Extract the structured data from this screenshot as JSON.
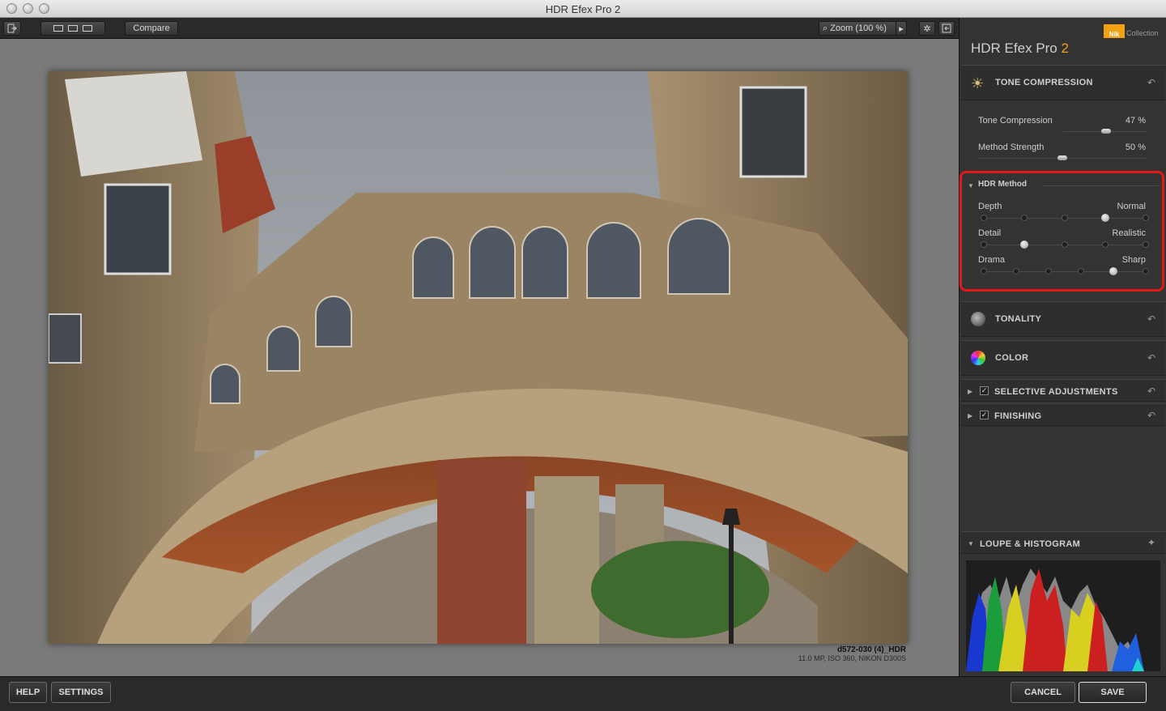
{
  "window": {
    "title": "HDR Efex Pro 2"
  },
  "toolbar": {
    "compare_label": "Compare",
    "zoom_label": "Zoom (100 %)"
  },
  "file": {
    "name": "d572-030 (4)_HDR",
    "meta": "11.0 MP, ISO 360, NIKON D300S"
  },
  "panel": {
    "brand": "Nik",
    "collection": "Collection",
    "app_name": "HDR Efex Pro",
    "app_version": "2",
    "tone_compression": {
      "title": "TONE COMPRESSION",
      "params": [
        {
          "label": "Tone Compression",
          "value_text": "47 %",
          "value": 47
        },
        {
          "label": "Method Strength",
          "value_text": "50 %",
          "value": 50
        }
      ]
    },
    "hdr_method": {
      "title": "HDR Method",
      "rows": [
        {
          "left": "Depth",
          "right": "Normal",
          "stops": 5,
          "selected": 3
        },
        {
          "left": "Detail",
          "right": "Realistic",
          "stops": 5,
          "selected": 1
        },
        {
          "left": "Drama",
          "right": "Sharp",
          "stops": 6,
          "selected": 4
        }
      ]
    },
    "tonality": {
      "title": "TONALITY"
    },
    "color": {
      "title": "COLOR"
    },
    "selective": {
      "title": "SELECTIVE ADJUSTMENTS"
    },
    "finishing": {
      "title": "FINISHING"
    },
    "loupe": {
      "title": "LOUPE & HISTOGRAM"
    }
  },
  "bottom": {
    "help": "HELP",
    "settings": "SETTINGS",
    "cancel": "CANCEL",
    "save": "SAVE"
  }
}
